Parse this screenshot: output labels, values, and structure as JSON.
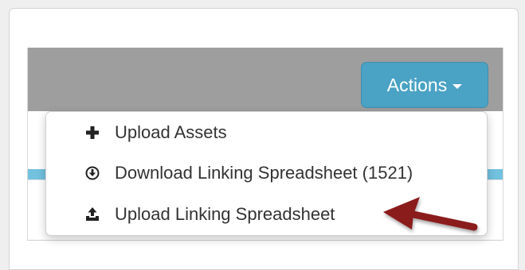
{
  "toolbar": {
    "actions_label": "Actions"
  },
  "menu": {
    "items": [
      {
        "label": "Upload Assets",
        "icon": "plus-icon"
      },
      {
        "label": "Download Linking Spreadsheet (1521)",
        "icon": "download-circle-icon"
      },
      {
        "label": "Upload Linking Spreadsheet",
        "icon": "upload-tray-icon"
      }
    ]
  },
  "colors": {
    "accent": "#4aa2c4",
    "header": "#9e9e9e",
    "stripe": "#72c1df",
    "annotation_arrow": "#8b1a1a"
  }
}
